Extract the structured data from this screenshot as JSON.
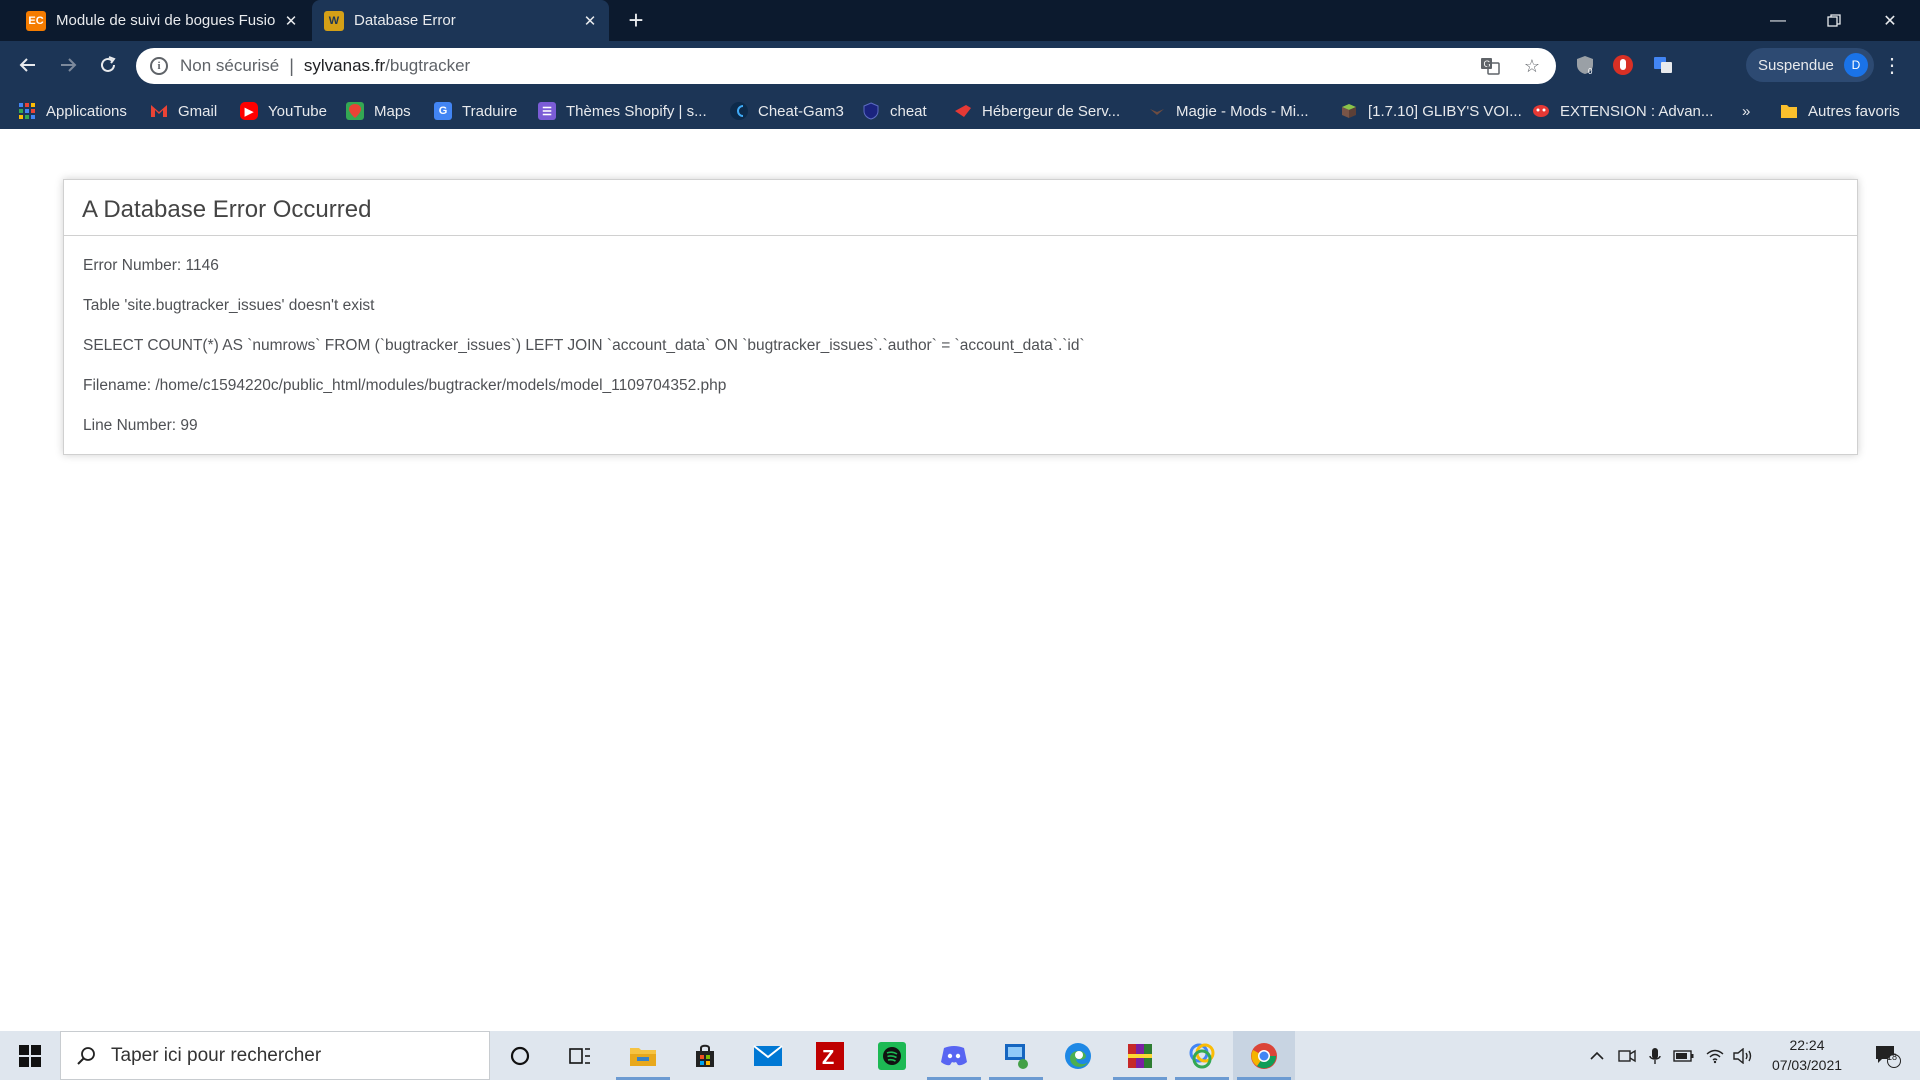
{
  "browser": {
    "tabs": [
      {
        "title": "Module de suivi de bogues Fusio",
        "favicon_text": "EC",
        "favicon_color": "#f57c00"
      },
      {
        "title": "Database Error",
        "favicon_text": "W",
        "favicon_color": "#d4a017"
      }
    ],
    "address": {
      "security_label": "Non sécurisé",
      "separator": "|",
      "host": "sylvanas.fr",
      "path": "/bugtracker"
    },
    "profile": {
      "label": "Suspendue",
      "initial": "D"
    },
    "bookmarks": [
      {
        "label": "Applications",
        "icon": "apps-grid-icon"
      },
      {
        "label": "Gmail",
        "icon": "gmail-icon"
      },
      {
        "label": "YouTube",
        "icon": "youtube-icon"
      },
      {
        "label": "Maps",
        "icon": "maps-icon"
      },
      {
        "label": "Traduire",
        "icon": "translate-icon"
      },
      {
        "label": "Thèmes Shopify | s...",
        "icon": "shopify-themes-icon"
      },
      {
        "label": "Cheat-Gam3",
        "icon": "cheat-gam3-icon"
      },
      {
        "label": "cheat",
        "icon": "shield-icon"
      },
      {
        "label": "Hébergeur de Serv...",
        "icon": "host-icon"
      },
      {
        "label": "Magie - Mods - Mi...",
        "icon": "magic-icon"
      },
      {
        "label": "[1.7.10] GLIBY'S VOI...",
        "icon": "block-icon"
      },
      {
        "label": "EXTENSION : Advan...",
        "icon": "extension-icon"
      }
    ],
    "bookmarks_overflow": "»",
    "other_bookmarks": "Autres favoris"
  },
  "page": {
    "heading": "A Database Error Occurred",
    "error_number": "Error Number: 1146",
    "message": "Table 'site.bugtracker_issues' doesn't exist",
    "query": "SELECT COUNT(*) AS `numrows` FROM (`bugtracker_issues`) LEFT JOIN `account_data` ON `bugtracker_issues`.`author` = `account_data`.`id`",
    "filename": "Filename: /home/c1594220c/public_html/modules/bugtracker/models/model_1109704352.php",
    "line_number": "Line Number: 99"
  },
  "taskbar": {
    "search_placeholder": "Taper ici pour rechercher",
    "apps": [
      "cortana-icon",
      "task-view-icon",
      "file-explorer-icon",
      "store-icon",
      "mail-icon",
      "filezilla-icon",
      "spotify-icon",
      "discord-icon",
      "network-app-icon",
      "edge-icon",
      "winrar-icon",
      "photos-icon",
      "chrome-icon"
    ],
    "time": "22:24",
    "date": "07/03/2021",
    "notification_count": "18"
  },
  "colors": {
    "tabstrip": "#0c1a2e",
    "toolbar": "#1c3556",
    "page_bg": "#ffffff",
    "taskbar": "#dfe6ee"
  }
}
